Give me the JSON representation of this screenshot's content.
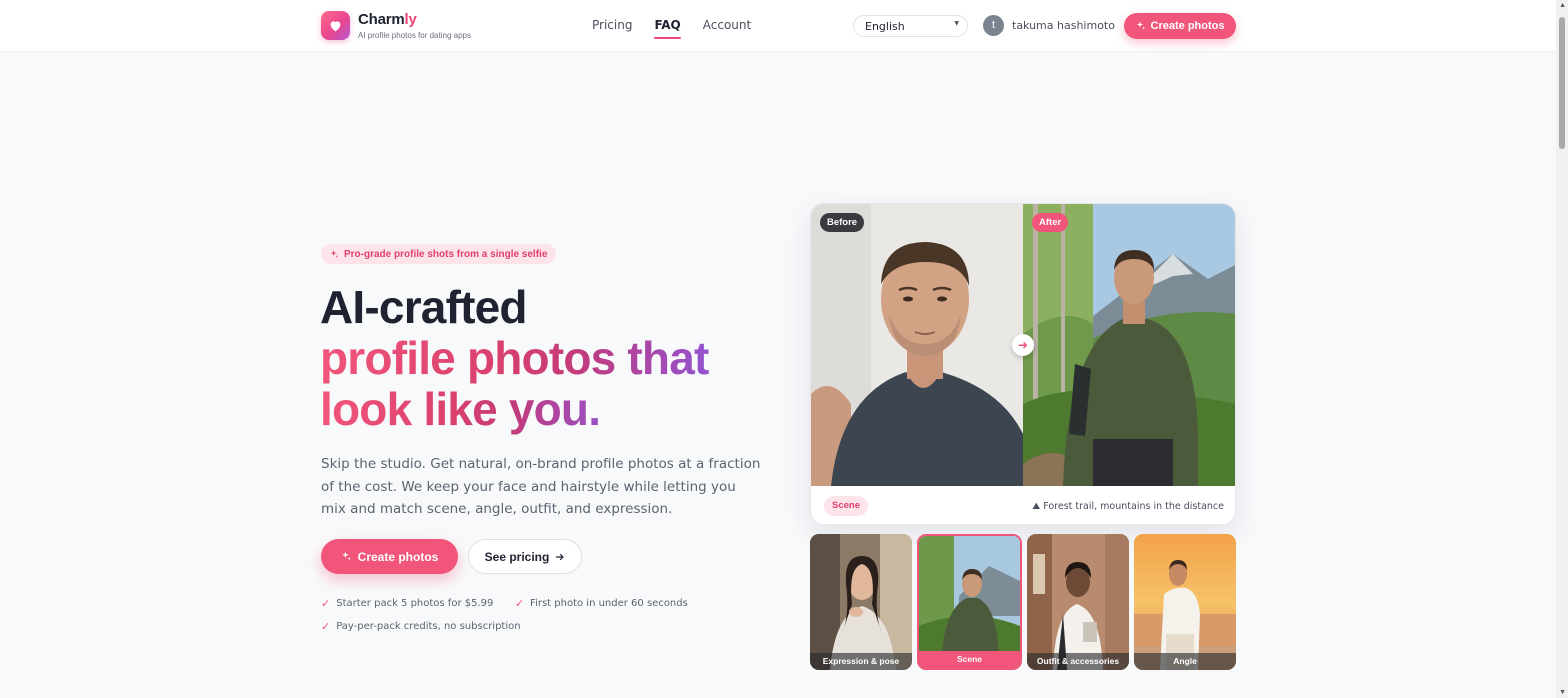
{
  "header": {
    "brand_main": "Charm",
    "brand_accent": "ly",
    "tagline": "AI profile photos for dating apps",
    "nav": [
      {
        "label": "Pricing",
        "active": false
      },
      {
        "label": "FAQ",
        "active": true
      },
      {
        "label": "Account",
        "active": false
      }
    ],
    "language": "English",
    "user_initial": "t",
    "user_name": "takuma hashimoto",
    "cta_label": "Create photos"
  },
  "hero": {
    "pill": "Pro-grade profile shots from a single selfie",
    "headline_line1": "AI-crafted",
    "headline_line2": "profile photos that",
    "headline_line3": "look like you.",
    "description": "Skip the studio. Get natural, on-brand profile photos at a fraction of the cost. We keep your face and hairstyle while letting you mix and match scene, angle, outfit, and expression.",
    "primary_cta": "Create photos",
    "secondary_cta": "See pricing",
    "features": [
      "Starter pack 5 photos for $5.99",
      "First photo in under 60 seconds",
      "Pay-per-pack credits, no subscription"
    ]
  },
  "comparison": {
    "before_label": "Before",
    "after_label": "After",
    "scene_chip": "Scene",
    "scene_description": "Forest trail, mountains in the distance",
    "thumbnails": [
      {
        "label": "Expression & pose",
        "active": false
      },
      {
        "label": "Scene",
        "active": true
      },
      {
        "label": "Outfit & accessories",
        "active": false
      },
      {
        "label": "Angle",
        "active": false
      }
    ]
  },
  "colors": {
    "accent": "#f2557a",
    "accent_soft": "#fde4ea",
    "gradient_end": "#8f55d8",
    "text_dark": "#1f2230"
  }
}
